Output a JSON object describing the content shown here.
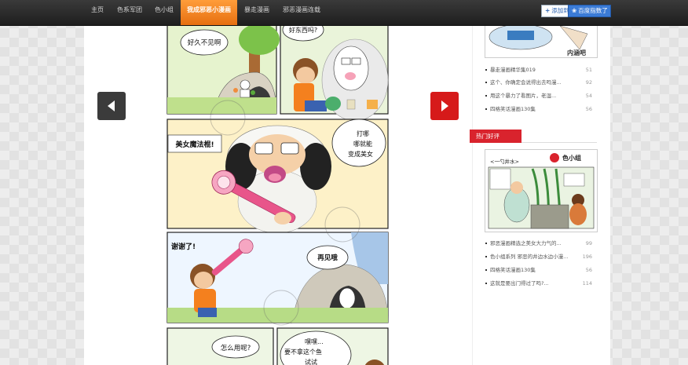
{
  "nav": {
    "items": [
      {
        "label": "主页",
        "active": false
      },
      {
        "label": "色系军团",
        "active": false
      },
      {
        "label": "色小组",
        "active": false
      },
      {
        "label": "我成邪恶小漫画",
        "active": true
      },
      {
        "label": "暴走漫画",
        "active": false
      },
      {
        "label": "邪恶漫画连载",
        "active": false
      }
    ],
    "fav_label": "添加到",
    "home_label": "百度指数了"
  },
  "comic": {
    "panel1_bubble": "好久不见啊",
    "panel2_bubble": "好东西吗?",
    "panel3_left": "美女魔法棍!",
    "panel3_right": "打哪\n哪就能\n变成美女",
    "panel4_left": "谢谢了!",
    "panel4_right": "再见哦",
    "panel5_left": "怎么用呢?",
    "panel5_right": "嘿嘿...\n要不拿这个鱼\n试试"
  },
  "sidebar": {
    "thumb1_caption": "内涵吧",
    "list1": [
      {
        "title": "暴走漫画精华集019",
        "count": "51"
      },
      {
        "title": "这个、你确定会说得出去吗漫...",
        "count": "92"
      },
      {
        "title": "用这个暴力了看图片，老湿...",
        "count": "54"
      },
      {
        "title": "四格笑话漫画130集",
        "count": "56"
      }
    ],
    "section_title": "热门好评",
    "thumb2_title": "<一勺井水>",
    "thumb2_logo": "色小组",
    "list2": [
      {
        "title": "邪恶漫画精选之美女大力气的...",
        "count": "99"
      },
      {
        "title": "色小组系列 邪恶的井边水边小漫...",
        "count": "196"
      },
      {
        "title": "四格笑话漫画130集",
        "count": "56"
      },
      {
        "title": "这就是要出门得过了吗?...",
        "count": "114"
      }
    ]
  },
  "colors": {
    "nav_active": "#f0821e",
    "prev_arrow": "#3b3b3b",
    "next_arrow": "#d61a1a",
    "section_head": "#d9232d"
  }
}
